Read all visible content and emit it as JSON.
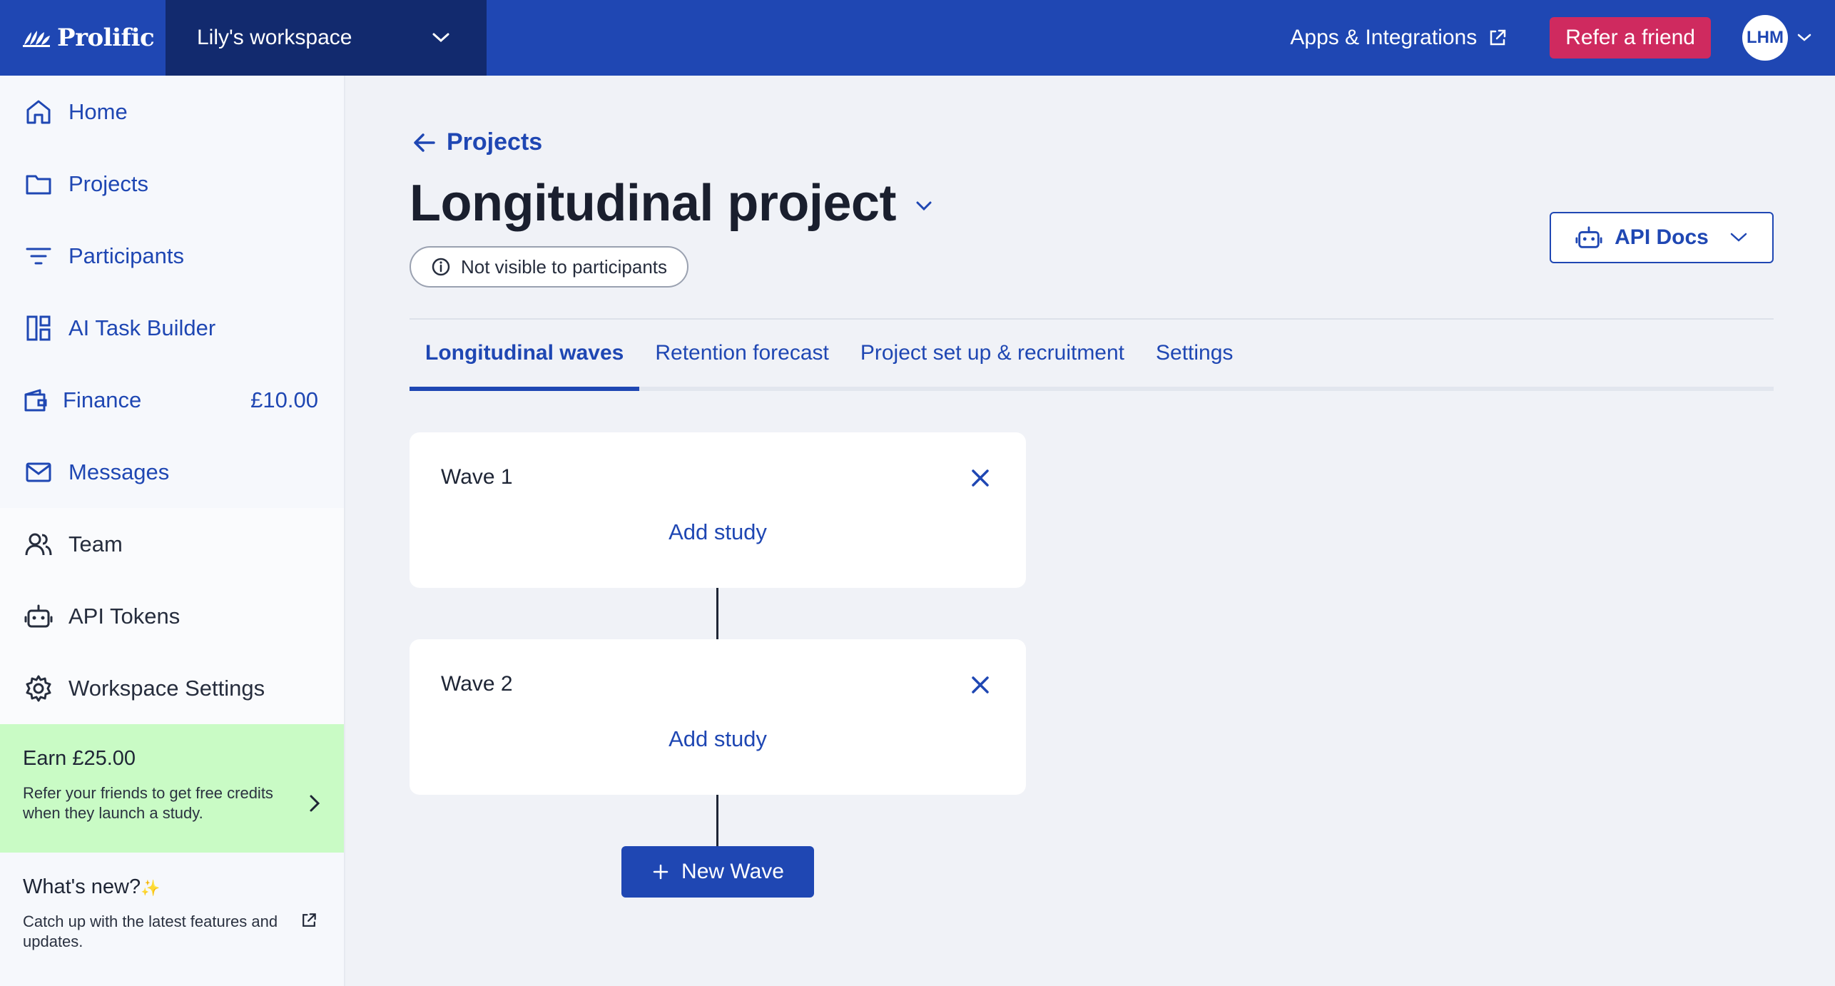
{
  "topbar": {
    "brand": "Prolific",
    "workspace": "Lily's workspace",
    "apps_link": "Apps & Integrations",
    "refer_button": "Refer a friend",
    "avatar_initials": "LHM"
  },
  "sidebar": {
    "items": [
      {
        "label": "Home",
        "icon": "home-icon"
      },
      {
        "label": "Projects",
        "icon": "folder-icon"
      },
      {
        "label": "Participants",
        "icon": "filter-icon"
      },
      {
        "label": "AI Task Builder",
        "icon": "layout-icon"
      },
      {
        "label": "Finance",
        "icon": "wallet-icon",
        "amount": "£10.00"
      },
      {
        "label": "Messages",
        "icon": "mail-icon"
      }
    ],
    "workspace_items": [
      {
        "label": "Team",
        "icon": "users-icon"
      },
      {
        "label": "API Tokens",
        "icon": "robot-icon"
      },
      {
        "label": "Workspace Settings",
        "icon": "gear-icon"
      }
    ],
    "earn": {
      "title": "Earn £25.00",
      "text": "Refer your friends to get free credits when they launch a study."
    },
    "whats_new": {
      "title": "What's new?",
      "sparkle": "✨",
      "text": "Catch up with the latest features and updates."
    }
  },
  "main": {
    "back_label": "Projects",
    "title": "Longitudinal project",
    "visibility": "Not visible to participants",
    "api_docs": "API Docs",
    "tabs": [
      {
        "label": "Longitudinal waves",
        "active": true
      },
      {
        "label": "Retention forecast",
        "active": false
      },
      {
        "label": "Project set up & recruitment",
        "active": false
      },
      {
        "label": "Settings",
        "active": false
      }
    ],
    "waves": [
      {
        "name": "Wave 1",
        "action": "Add study"
      },
      {
        "name": "Wave 2",
        "action": "Add study"
      }
    ],
    "new_wave": "New Wave"
  },
  "colors": {
    "brand_blue": "#1f47b3",
    "workspace_bg": "#122a6e",
    "refer_pink": "#cf2a5f",
    "earn_green": "#c9fbc5"
  }
}
